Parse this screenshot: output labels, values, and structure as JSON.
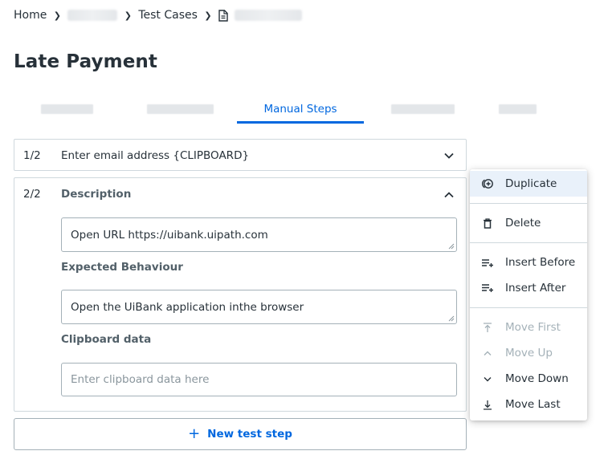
{
  "breadcrumb": {
    "home": "Home",
    "project_redacted": "",
    "test_cases": "Test Cases",
    "case_redacted": ""
  },
  "page_title": "Late Payment",
  "tabs": [
    {
      "label": "",
      "redacted": true
    },
    {
      "label": "",
      "redacted": true
    },
    {
      "label": "Manual Steps",
      "active": true
    },
    {
      "label": "",
      "redacted": true
    },
    {
      "label": "",
      "redacted": true
    }
  ],
  "steps": [
    {
      "number": "1/2",
      "text": "Enter email address {CLIPBOARD}",
      "expanded": false
    },
    {
      "number": "2/2",
      "title": "Description",
      "expanded": true,
      "description_value": "Open URL https://uibank.uipath.com",
      "expected_label": "Expected Behaviour",
      "expected_value": "Open the UiBank application inthe browser",
      "clipboard_label": "Clipboard data",
      "clipboard_placeholder": "Enter clipboard data here"
    }
  ],
  "new_step_label": "New test step",
  "context_menu": {
    "items": [
      {
        "label": "Duplicate",
        "icon": "duplicate-icon",
        "disabled": false,
        "highlighted": true
      },
      {
        "label": "Delete",
        "icon": "trash-icon",
        "disabled": false
      },
      {
        "label": "Insert Before",
        "icon": "insert-before-icon",
        "disabled": false
      },
      {
        "label": "Insert After",
        "icon": "insert-after-icon",
        "disabled": false
      },
      {
        "label": "Move First",
        "icon": "move-first-icon",
        "disabled": true
      },
      {
        "label": "Move Up",
        "icon": "chevron-up-icon",
        "disabled": true
      },
      {
        "label": "Move Down",
        "icon": "chevron-down-icon",
        "disabled": false
      },
      {
        "label": "Move Last",
        "icon": "move-last-icon",
        "disabled": false
      }
    ]
  },
  "colors": {
    "accent": "#0067df",
    "text": "#273139",
    "border": "#cfd8dd",
    "menu_highlight": "#e9f1fa",
    "disabled": "#a4b1b8"
  }
}
